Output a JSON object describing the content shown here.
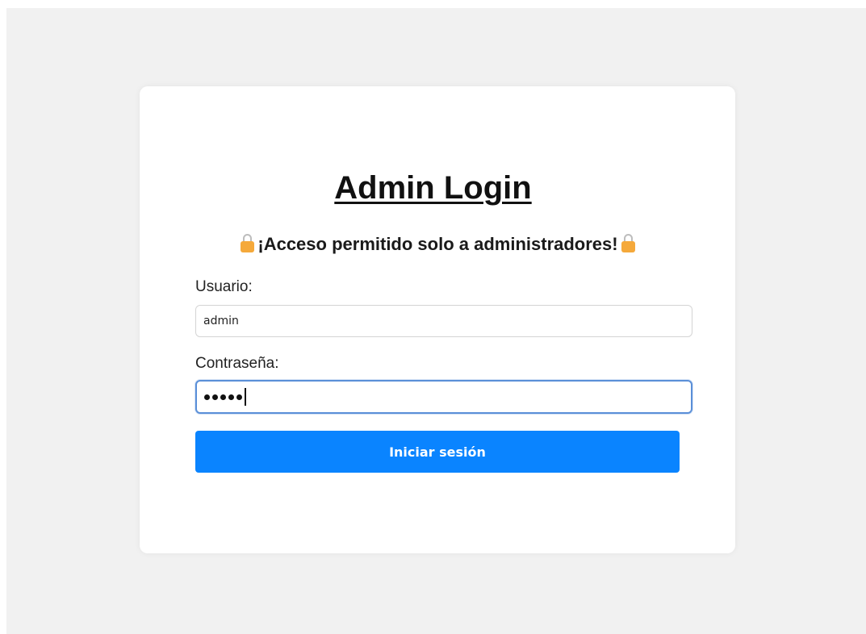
{
  "page": {
    "title": "Admin Login",
    "warning_text": "¡Acceso permitido solo a administradores!",
    "warning_icon": "lock-icon"
  },
  "form": {
    "username_label": "Usuario:",
    "username_value": "admin",
    "password_label": "Contraseña:",
    "password_masked_length": 5,
    "submit_label": "Iniciar sesión"
  },
  "colors": {
    "page_background": "#f1f1f1",
    "card_background": "#ffffff",
    "button_primary": "#0a84ff",
    "focus_border": "#5a8fd8",
    "lock_body": "#f5a93b"
  }
}
